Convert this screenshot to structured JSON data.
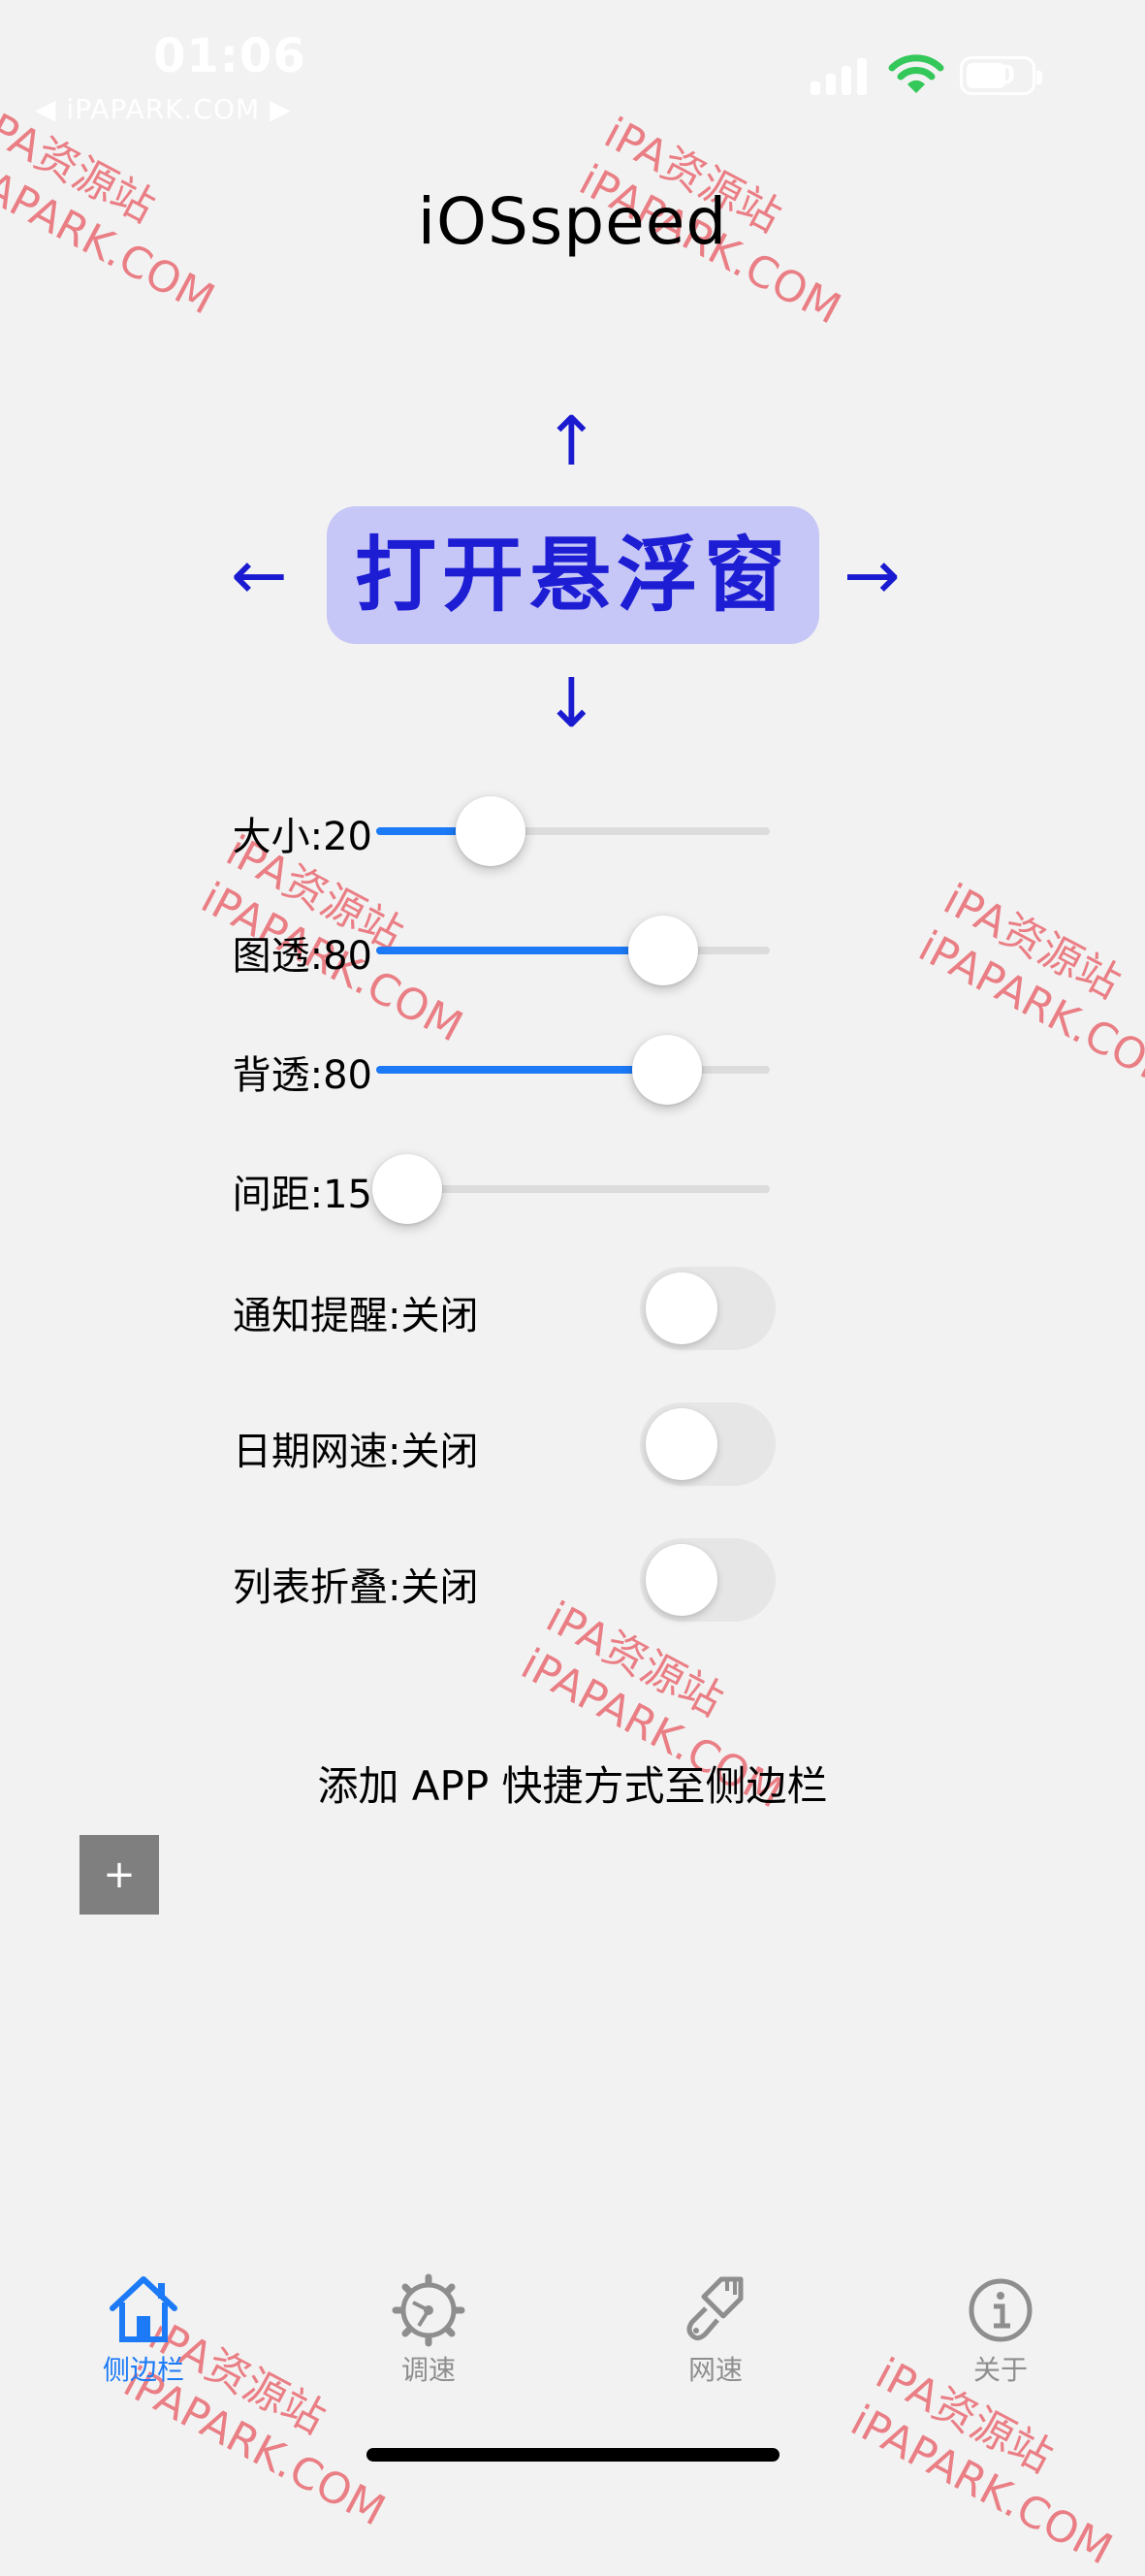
{
  "status_bar": {
    "time": "01:06",
    "back_label": "◀ iPAPARK.COM ▶",
    "battery": "40"
  },
  "app": {
    "title": "iOSspeed"
  },
  "float_window": {
    "button_label": "打开悬浮窗",
    "arrow_up": "↑",
    "arrow_down": "↓",
    "arrow_left": "←",
    "arrow_right": "→"
  },
  "sliders": [
    {
      "label": "大小:20",
      "value": 0.29
    },
    {
      "label": "图透:80",
      "value": 0.73
    },
    {
      "label": "背透:80",
      "value": 0.74
    },
    {
      "label": "间距:15",
      "value": 0.08
    }
  ],
  "toggles": [
    {
      "label": "通知提醒:关闭",
      "on": false
    },
    {
      "label": "日期网速:关闭",
      "on": false
    },
    {
      "label": "列表折叠:关闭",
      "on": false
    }
  ],
  "shortcut": {
    "label": "添加 APP 快捷方式至侧边栏",
    "add_button": "+"
  },
  "tab_bar": [
    {
      "label": "侧边栏",
      "icon": "house-icon",
      "active": true
    },
    {
      "label": "调速",
      "icon": "gear-speed-icon",
      "active": false
    },
    {
      "label": "网速",
      "icon": "paintbrush-icon",
      "active": false
    },
    {
      "label": "关于",
      "icon": "info-icon",
      "active": false
    }
  ],
  "watermark": {
    "line1": "iPA资源站",
    "line2": "iPAPARK.COM"
  },
  "colors": {
    "accent": "#1c7af7",
    "float_button_bg": "#c7c7f7",
    "float_button_text": "#1d1dd4",
    "arrows": "#1a1ad0"
  }
}
